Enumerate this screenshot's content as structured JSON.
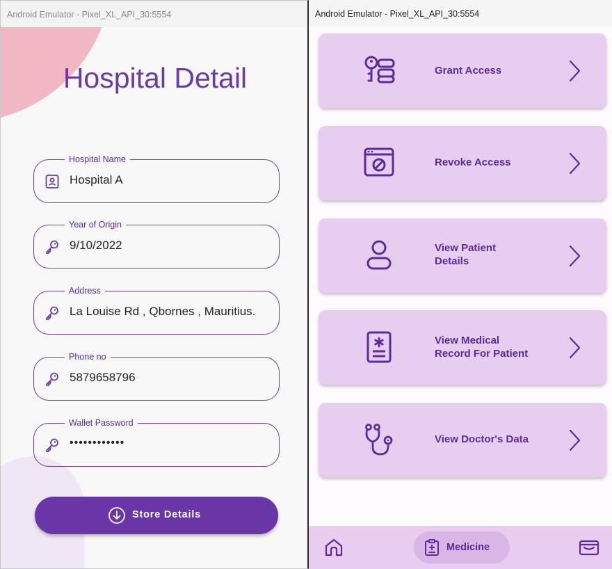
{
  "left_window": {
    "title": "Android Emulator - Pixel_XL_API_30:5554",
    "page_title": "Hospital Detail",
    "fields": [
      {
        "label": "Hospital Name",
        "value": "Hospital A",
        "icon": "id-badge-icon"
      },
      {
        "label": "Year of Origin",
        "value": "9/10/2022",
        "icon": "key-icon"
      },
      {
        "label": "Address",
        "value": "La Louise Rd , Qbornes , Mauritius.",
        "icon": "key-icon"
      },
      {
        "label": "Phone no",
        "value": "5879658796",
        "icon": "key-icon"
      },
      {
        "label": "Wallet Password",
        "value": "••••••••••••",
        "icon": "key-icon"
      }
    ],
    "store_button": {
      "label": "Store Details",
      "icon": "download-circle-icon"
    }
  },
  "right_window": {
    "title": "Android Emulator - Pixel_XL_API_30:5554",
    "cards": [
      {
        "line1": "Grant Access",
        "line2": "",
        "icon": "key-list-icon"
      },
      {
        "line1": "Revoke Access",
        "line2": "",
        "icon": "browser-block-icon"
      },
      {
        "line1": "View Patient",
        "line2": "Details",
        "icon": "person-icon"
      },
      {
        "line1": "View Medical",
        "line2": "Record For Patient",
        "icon": "medical-record-icon"
      },
      {
        "line1": "View Doctor's Data",
        "line2": "",
        "icon": "stethoscope-icon"
      }
    ],
    "bottom_nav": {
      "home_icon": "home-icon",
      "active": {
        "label": "Medicine",
        "icon": "clipboard-icon"
      },
      "wallet_icon": "wallet-icon"
    }
  },
  "colors": {
    "primary": "#6a35a6",
    "card_bg": "#e7cdee",
    "accent_text": "#5b2a9c",
    "blob_pink": "#f1b8c4"
  }
}
